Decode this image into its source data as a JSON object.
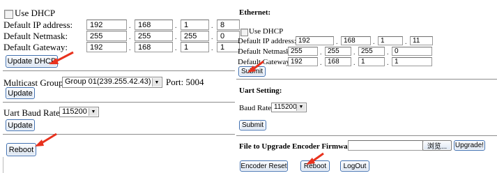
{
  "left": {
    "dhcp_checkbox_label": "Use DHCP",
    "ip_label": "Default IP address:",
    "ip": [
      "192",
      "168",
      "1",
      "8"
    ],
    "netmask_label": "Default Netmask:",
    "netmask": [
      "255",
      "255",
      "255",
      "0"
    ],
    "gateway_label": "Default Gateway:",
    "gateway": [
      "192",
      "168",
      "1",
      "1"
    ],
    "update_dhcp_button": "Update DHCP",
    "multicast_label": "Multicast Group:",
    "multicast_value": "Group 01(239.255.42.43)",
    "port_label": "Port: 5004",
    "update_button_1": "Update",
    "uart_label": "Uart Baud Rate:",
    "uart_value": "115200",
    "update_button_2": "Update",
    "reboot_button": "Reboot"
  },
  "right": {
    "ethernet_heading": "Ethernet:",
    "dhcp_checkbox_label": "Use DHCP",
    "ip_label": "Default IP address:",
    "ip": [
      "192",
      "168",
      "1",
      "11"
    ],
    "netmask_label": "Default Netmask:",
    "netmask": [
      "255",
      "255",
      "255",
      "0"
    ],
    "gateway_label": "Default Gateway:",
    "gateway": [
      "192",
      "168",
      "1",
      "1"
    ],
    "submit_button_1": "Submit",
    "uart_heading": "Uart Setting:",
    "baud_label": "Baud Rate:",
    "baud_value": "115200",
    "submit_button_2": "Submit",
    "upgrade_label": "File to Upgrade Encoder Firmware:",
    "browse_button": "浏览...",
    "upgrade_button": "Upgrade!",
    "encoder_reset_button": "Encoder Reset",
    "reboot_button": "Reboot",
    "logout_button": "LogOut"
  },
  "colors": {
    "annotation_arrow": "#e8321e",
    "button_border": "#3f6fb0"
  },
  "icons": {
    "dropdown": "chevron-down-icon",
    "annotation": "red-arrow-icon"
  }
}
